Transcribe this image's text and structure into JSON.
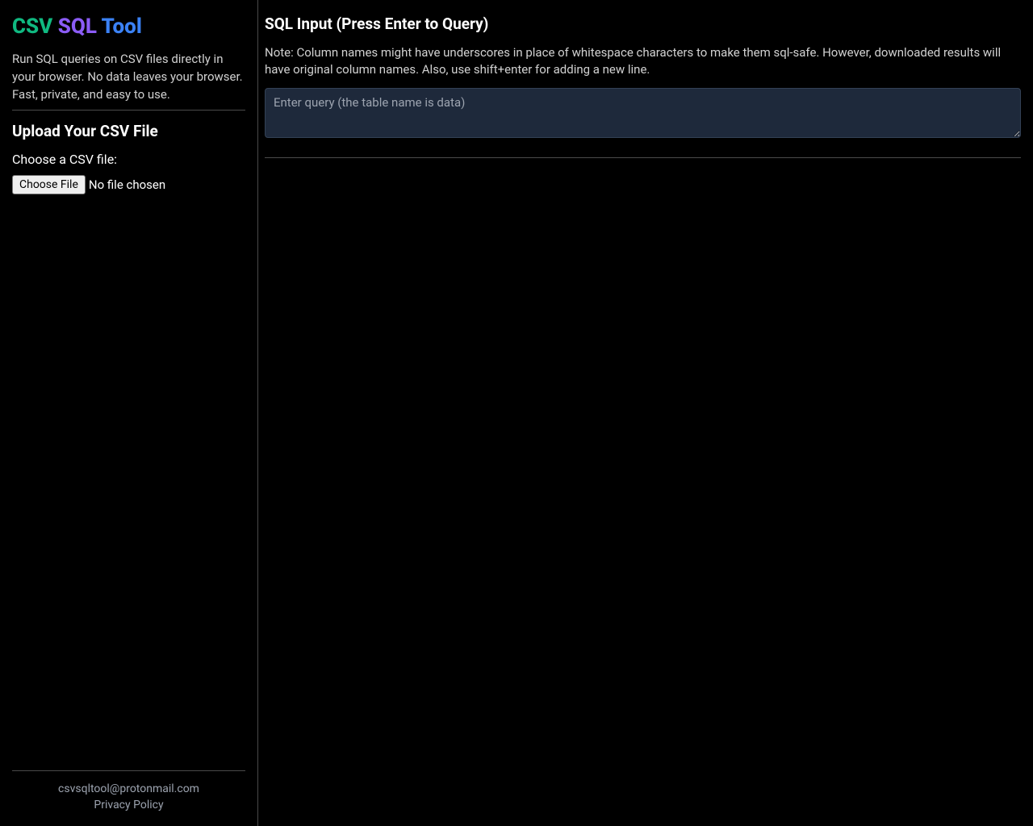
{
  "sidebar": {
    "title": {
      "csv": "CSV",
      "sql": "SQL",
      "tool": "Tool"
    },
    "description_line1": "Run SQL queries on CSV files directly in your browser. No data leaves your browser.",
    "description_line2": "Fast, private, and easy to use.",
    "upload_heading": "Upload Your CSV File",
    "choose_label": "Choose a CSV file:",
    "file_button": "Choose File",
    "file_status": "No file chosen",
    "footer": {
      "email": "csvsqltool@protonmail.com",
      "privacy": "Privacy Policy"
    }
  },
  "main": {
    "sql_heading": "SQL Input (Press Enter to Query)",
    "sql_note": "Note: Column names might have underscores in place of whitespace characters to make them sql-safe. However, downloaded results will have original column names. Also, use shift+enter for adding a new line.",
    "sql_placeholder": "Enter query (the table name is data)"
  }
}
